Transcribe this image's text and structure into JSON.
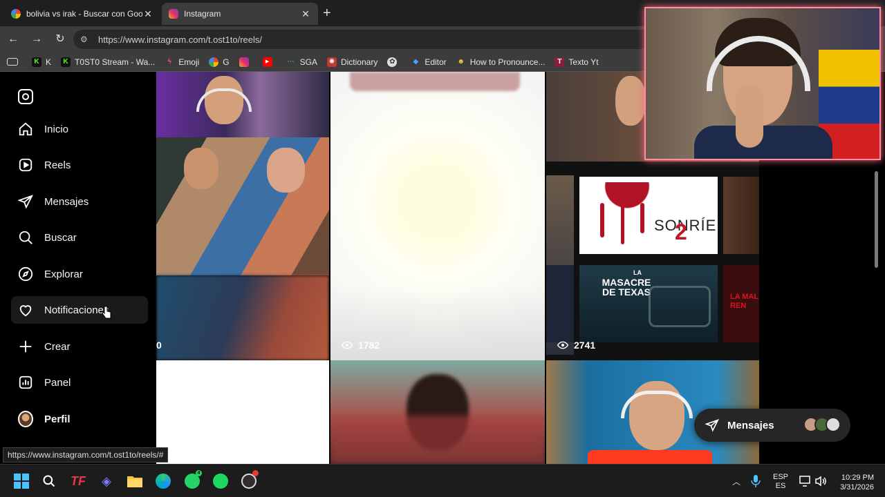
{
  "browser": {
    "tabs": [
      {
        "title": "bolivia vs irak - Buscar con Google",
        "active": false
      },
      {
        "title": "Instagram",
        "active": true
      }
    ],
    "url": "https://www.instagram.com/t.ost1to/reels/"
  },
  "bookmarks": [
    {
      "label": "K",
      "icon": "kick-icon"
    },
    {
      "label": "T0ST0 Stream - Wa...",
      "icon": "kick-icon"
    },
    {
      "label": "Emoji",
      "icon": "bolt-icon"
    },
    {
      "label": "G",
      "icon": "google-icon"
    },
    {
      "label": "",
      "icon": "instagram-icon"
    },
    {
      "label": "",
      "icon": "youtube-icon"
    },
    {
      "label": "SGA",
      "icon": "sga-icon"
    },
    {
      "label": "Dictionary",
      "icon": "dictionary-icon"
    },
    {
      "label": "",
      "icon": "chatgpt-icon"
    },
    {
      "label": "Editor",
      "icon": "editor-icon"
    },
    {
      "label": "How to Pronounce...",
      "icon": "pronounce-icon"
    },
    {
      "label": "Texto Yt",
      "icon": "texto-icon"
    }
  ],
  "sidebar": {
    "items": [
      {
        "label": "Inicio",
        "icon": "home-icon"
      },
      {
        "label": "Reels",
        "icon": "reels-icon"
      },
      {
        "label": "Mensajes",
        "icon": "messages-icon"
      },
      {
        "label": "Buscar",
        "icon": "search-icon"
      },
      {
        "label": "Explorar",
        "icon": "explore-icon"
      },
      {
        "label": "Notificaciones",
        "icon": "heart-icon"
      },
      {
        "label": "Crear",
        "icon": "plus-icon"
      },
      {
        "label": "Panel",
        "icon": "panel-icon"
      },
      {
        "label": "Perfil",
        "icon": "avatar"
      }
    ]
  },
  "reels": {
    "views": [
      "0",
      "1782",
      "2741"
    ],
    "sonrie_text": "SONRÍE",
    "sonrie_number": "2",
    "masacre_small": "LA",
    "masacre_title": "MASACRE\nDE TEXAS",
    "side_text_1": "LA MAL\nREN"
  },
  "messages_pill": {
    "label": "Mensajes"
  },
  "status_url": "https://www.instagram.com/t.ost1to/reels/#",
  "taskbar": {
    "lang_top": "ESP",
    "lang_bottom": "ES",
    "time": "10:29 PM",
    "date": "3/31/2026",
    "whatsapp_badge": "4"
  },
  "colors": {
    "browser_bg": "#1f1f1f",
    "toolbar": "#3c3c3c",
    "ig_bg": "#000000",
    "webcam_border": "#ff8fa0"
  }
}
